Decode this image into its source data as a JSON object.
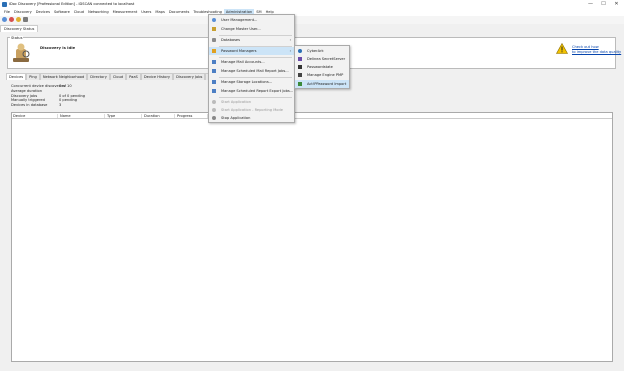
{
  "window": {
    "title": "iDoc Discovery [Professional Edition] - iDSCAN connected to localhost",
    "controls": [
      "—",
      "☐",
      "✕"
    ]
  },
  "menubar": [
    "File",
    "Discovery",
    "Devices",
    "Software",
    "Cloud",
    "Networking",
    "Measurement",
    "Users",
    "Maps",
    "Documents",
    "Troubleshooting",
    "Administration",
    "SM",
    "Help"
  ],
  "active_menu": "Administration",
  "doc_tab": "Discovery Status",
  "status": {
    "legend": "Status",
    "message": "Discovery is idle",
    "warning_link_line1": "Check out how",
    "warning_link_line2": "to improve the data quality"
  },
  "subtabs": [
    "Devices",
    "Ping",
    "Network Neighborhood",
    "Directory",
    "Cloud",
    "PaaS",
    "Device History",
    "Discovery Jobs",
    "Measurement",
    "Data Quality"
  ],
  "info": [
    {
      "label": "Concurrent device discoveries",
      "value": "0 of 10"
    },
    {
      "label": "Average duration",
      "value": ""
    },
    {
      "label": "Discovery jobs",
      "value": "0 of 0 pending"
    },
    {
      "label": "Manually triggered",
      "value": "0 pending"
    },
    {
      "label": "Devices in database",
      "value": "3"
    }
  ],
  "grid_columns": [
    "Device",
    "Name",
    "Type",
    "Duration",
    "Progress"
  ],
  "admin_menu": {
    "items": [
      {
        "label": "User Management...",
        "icon": "users-icon"
      },
      {
        "label": "Change Master User...",
        "icon": "key-icon"
      },
      {
        "label": "Databases",
        "icon": "database-icon",
        "submenu": true
      },
      {
        "label": "Password Managers",
        "icon": "password-manager-icon",
        "submenu": true,
        "highlighted": true
      },
      {
        "label": "Manage Mail Accounts...",
        "icon": "mail-icon"
      },
      {
        "label": "Manage Scheduled Mail Report Jobs...",
        "icon": "mail-schedule-icon"
      },
      {
        "label": "Manage Storage Locations...",
        "icon": "storage-icon"
      },
      {
        "label": "Manage Scheduled Report Export Jobs...",
        "icon": "report-export-icon"
      },
      {
        "label": "Start Application",
        "icon": "start-icon",
        "disabled": true
      },
      {
        "label": "Start Application - Reporting Mode",
        "icon": "start-reporting-icon",
        "disabled": true
      },
      {
        "label": "Stop Application",
        "icon": "stop-icon"
      }
    ]
  },
  "password_submenu": {
    "items": [
      {
        "label": "CyberArk",
        "icon": "cyberark-icon"
      },
      {
        "label": "Delinea SecretServer",
        "icon": "delinea-icon"
      },
      {
        "label": "Passwordstate",
        "icon": "passwordstate-icon"
      },
      {
        "label": "Manage Engine PMP",
        "icon": "manageengine-icon"
      },
      {
        "label": "Act!PPassword Import",
        "icon": "import-icon",
        "highlighted": true
      }
    ]
  },
  "colors": {
    "highlight": "#cce4f7",
    "link": "#0645ad",
    "warning": "#f2c200"
  }
}
